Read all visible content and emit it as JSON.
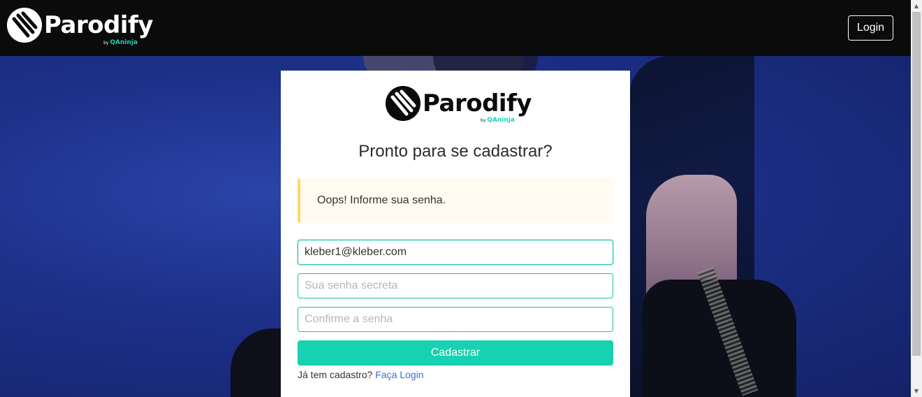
{
  "brand": {
    "name": "Parodify",
    "by": "by",
    "sub": "QAninja"
  },
  "nav": {
    "login_label": "Login"
  },
  "card": {
    "title": "Pronto para se cadastrar?",
    "alert": "Oops! Informe sua senha.",
    "email_value": "kleber1@kleber.com",
    "password_placeholder": "Sua senha secreta",
    "confirm_placeholder": "Confirme a senha",
    "submit_label": "Cadastrar",
    "footer_prefix": "Já tem cadastro?",
    "footer_link": "Faça Login"
  },
  "colors": {
    "accent": "#16d1b2",
    "navbar": "#0b0b0b",
    "alert_border": "#ffd966",
    "link": "#3b6fd1"
  },
  "icons": {
    "logo": "parodify-logo-icon"
  }
}
